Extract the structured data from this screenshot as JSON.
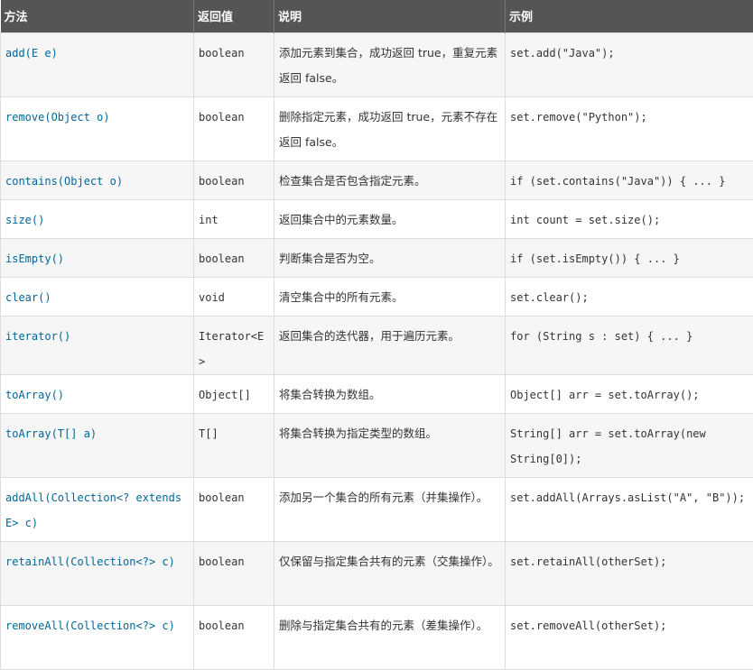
{
  "headers": [
    "方法",
    "返回值",
    "说明",
    "示例"
  ],
  "rows": [
    {
      "method": "add(E e)",
      "ret": "boolean",
      "desc": "添加元素到集合，成功返回 true，重复元素返回 false。",
      "example": "set.add(\"Java\");"
    },
    {
      "method": "remove(Object o)",
      "ret": "boolean",
      "desc": "删除指定元素，成功返回 true，元素不存在返回 false。",
      "example": "set.remove(\"Python\");"
    },
    {
      "method": "contains(Object o)",
      "ret": "boolean",
      "desc": "检查集合是否包含指定元素。",
      "example": "if (set.contains(\"Java\")) { ... }"
    },
    {
      "method": "size()",
      "ret": "int",
      "desc": "返回集合中的元素数量。",
      "example": "int count = set.size();"
    },
    {
      "method": "isEmpty()",
      "ret": "boolean",
      "desc": "判断集合是否为空。",
      "example": "if (set.isEmpty()) { ... }"
    },
    {
      "method": "clear()",
      "ret": "void",
      "desc": "清空集合中的所有元素。",
      "example": "set.clear();"
    },
    {
      "method": "iterator()",
      "ret": "Iterator<E>",
      "desc": "返回集合的迭代器，用于遍历元素。",
      "example": "for (String s : set) { ... }"
    },
    {
      "method": "toArray()",
      "ret": "Object[]",
      "desc": "将集合转换为数组。",
      "example": "Object[] arr = set.toArray();"
    },
    {
      "method": "toArray(T[] a)",
      "ret": "T[]",
      "desc": "将集合转换为指定类型的数组。",
      "example": "String[] arr = set.toArray(new String[0]);"
    },
    {
      "method": "addAll(Collection<? extends E> c)",
      "ret": "boolean",
      "desc": "添加另一个集合的所有元素（并集操作）。",
      "example": "set.addAll(Arrays.asList(\"A\", \"B\"));"
    },
    {
      "method": "retainAll(Collection<?> c)",
      "ret": "boolean",
      "desc": "仅保留与指定集合共有的元素（交集操作）。",
      "example": "set.retainAll(otherSet);"
    },
    {
      "method": "removeAll(Collection<?> c)",
      "ret": "boolean",
      "desc": "删除与指定集合共有的元素（差集操作）。",
      "example": "set.removeAll(otherSet);"
    }
  ]
}
